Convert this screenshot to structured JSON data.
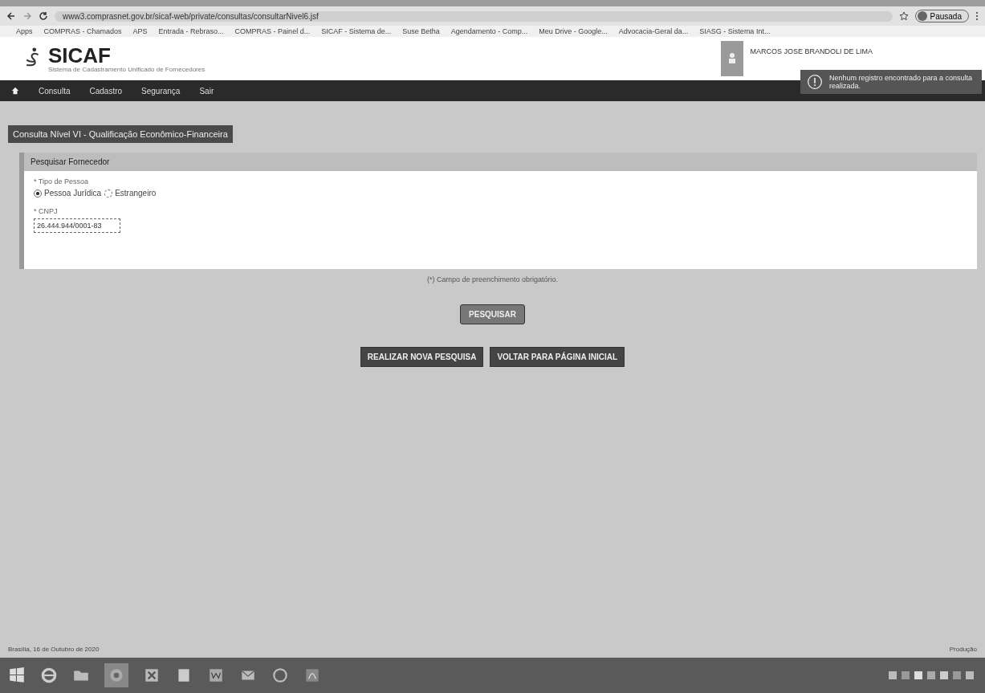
{
  "browser": {
    "url": "www3.comprasnet.gov.br/sicaf-web/private/consultas/consultarNivel6.jsf",
    "profile": "Pausada",
    "bookmarks": [
      "Apps",
      "COMPRAS - Chamados",
      "APS",
      "Entrada - Rebraso...",
      "COMPRAS - Painel d...",
      "SICAF - Sistema de...",
      "Suse Betha",
      "Agendamento - Comp...",
      "Meu Drive - Google...",
      "Advocacia-Geral da...",
      "SIASG - Sistema Int..."
    ]
  },
  "header": {
    "logo": "SICAF",
    "subtitle": "Sistema de Cadastramento Unificado de Fornecedores",
    "user": "MARCOS JOSE BRANDOLI DE LIMA"
  },
  "toast": {
    "message": "Nenhum registro encontrado para a consulta realizada."
  },
  "nav": [
    "Consulta",
    "Cadastro",
    "Segurança",
    "Sair"
  ],
  "page_title": "Consulta Nível VI - Qualificação Econômico-Financeira",
  "panel": {
    "title": "Pesquisar Fornecedor",
    "person_type_label": "* Tipo de Pessoa",
    "options": [
      {
        "label": "Pessoa Jurídica",
        "selected": true
      },
      {
        "label": "Estrangeiro",
        "selected": false
      }
    ],
    "cnpj_label": "* CNPJ",
    "cnpj_value": "26.444.944/0001-83"
  },
  "required_note": "(*) Campo de preenchimento obrigatório.",
  "search_button": "PESQUISAR",
  "actions": [
    "REALIZAR NOVA PESQUISA",
    "VOLTAR PARA PÁGINA INICIAL"
  ],
  "footer": {
    "date": "Brasília, 16 de Outubro de 2020",
    "environment": "Produção"
  }
}
